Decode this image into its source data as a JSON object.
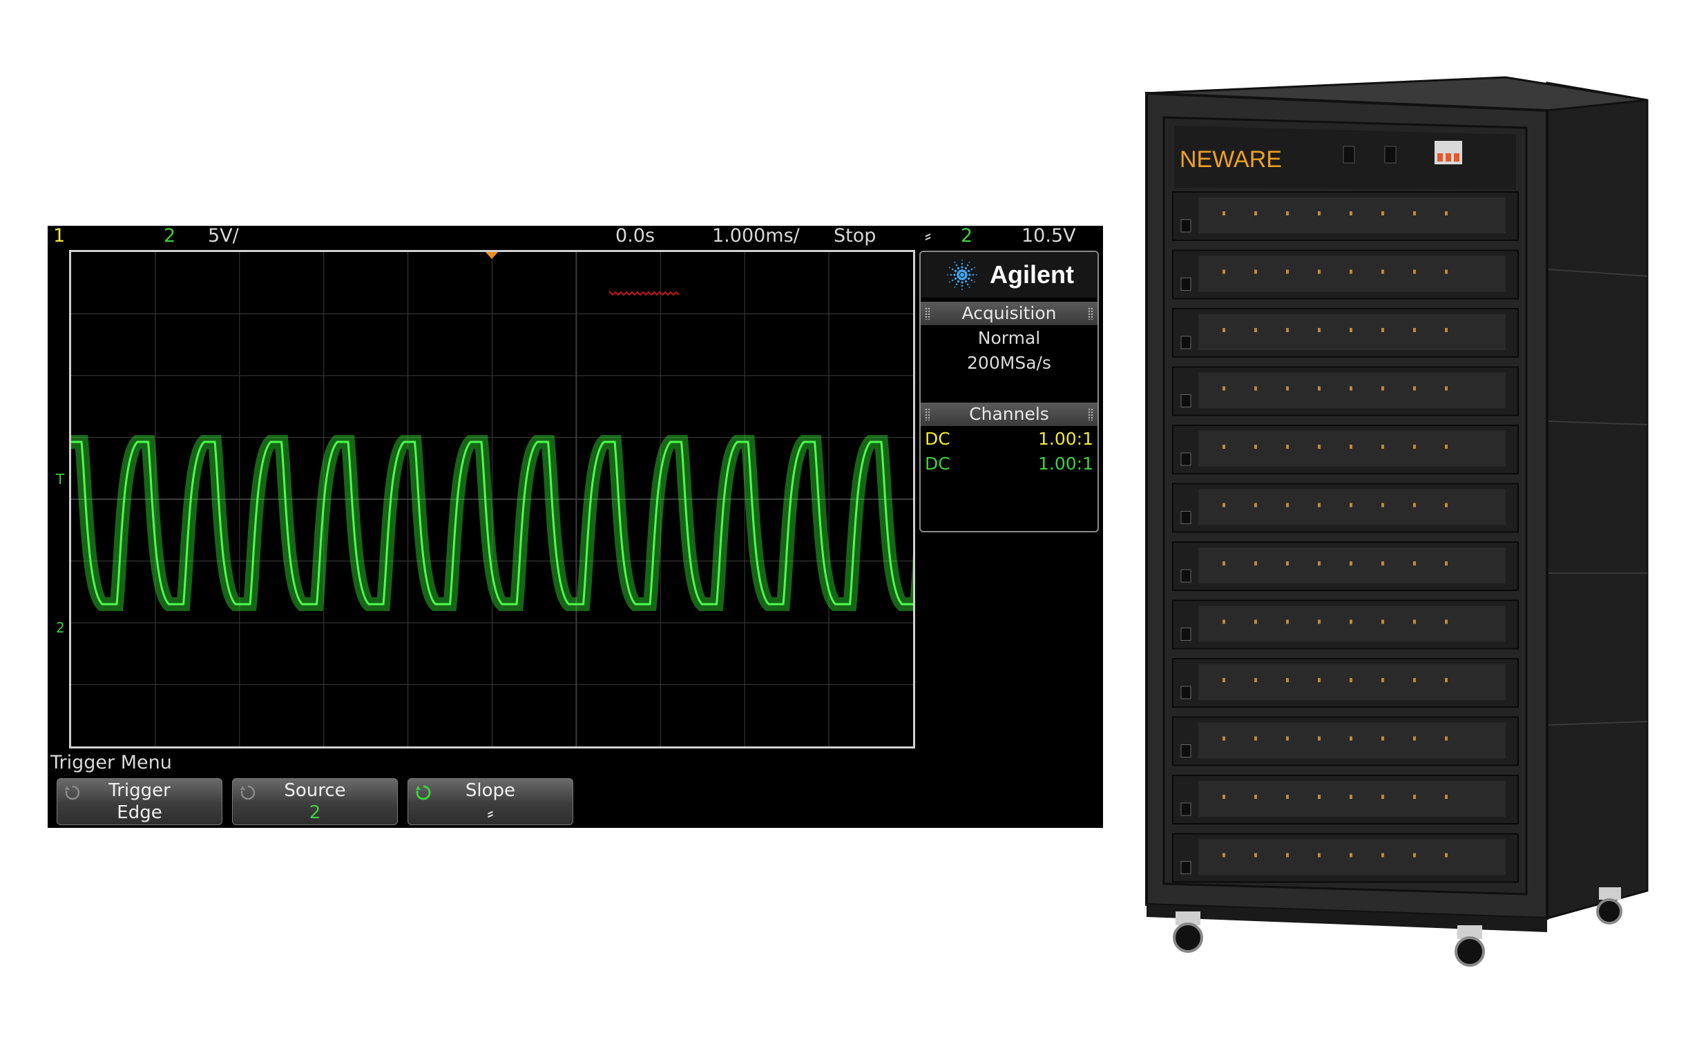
{
  "scope": {
    "status": {
      "ch1_number": "1",
      "ch2_number": "2",
      "ch2_scale": "5V/",
      "time_offset": "0.0s",
      "time_scale": "1.000ms/",
      "run_state": "Stop",
      "trigger_slope_symbol": "⸗",
      "trigger_channel": "2",
      "trigger_level": "10.5V"
    },
    "markers": {
      "trigger_marker": "T",
      "ch2_marker": "2"
    },
    "panel": {
      "brand": "Agilent",
      "acquisition_header": "Acquisition",
      "acquisition_mode": "Normal",
      "sample_rate": "200MSa/s",
      "channels_header": "Channels",
      "channels": [
        {
          "coupling": "DC",
          "probe": "1.00:1",
          "color": "#f2e83a"
        },
        {
          "coupling": "DC",
          "probe": "1.00:1",
          "color": "#3dd13d"
        }
      ]
    },
    "menu": {
      "title": "Trigger Menu",
      "softkeys": [
        {
          "label": "Trigger",
          "value": "Edge"
        },
        {
          "label": "Source",
          "value": "2"
        },
        {
          "label": "Slope",
          "value": "⸗"
        }
      ]
    },
    "colors": {
      "trace": "#33e033",
      "ch1": "#f2e83a",
      "ch2": "#3dd13d",
      "ref": "#c0181c"
    }
  },
  "cabinet": {
    "brand": "NEWARE",
    "brand_color": "#f0a020",
    "body_color": "#2b2b2b"
  }
}
